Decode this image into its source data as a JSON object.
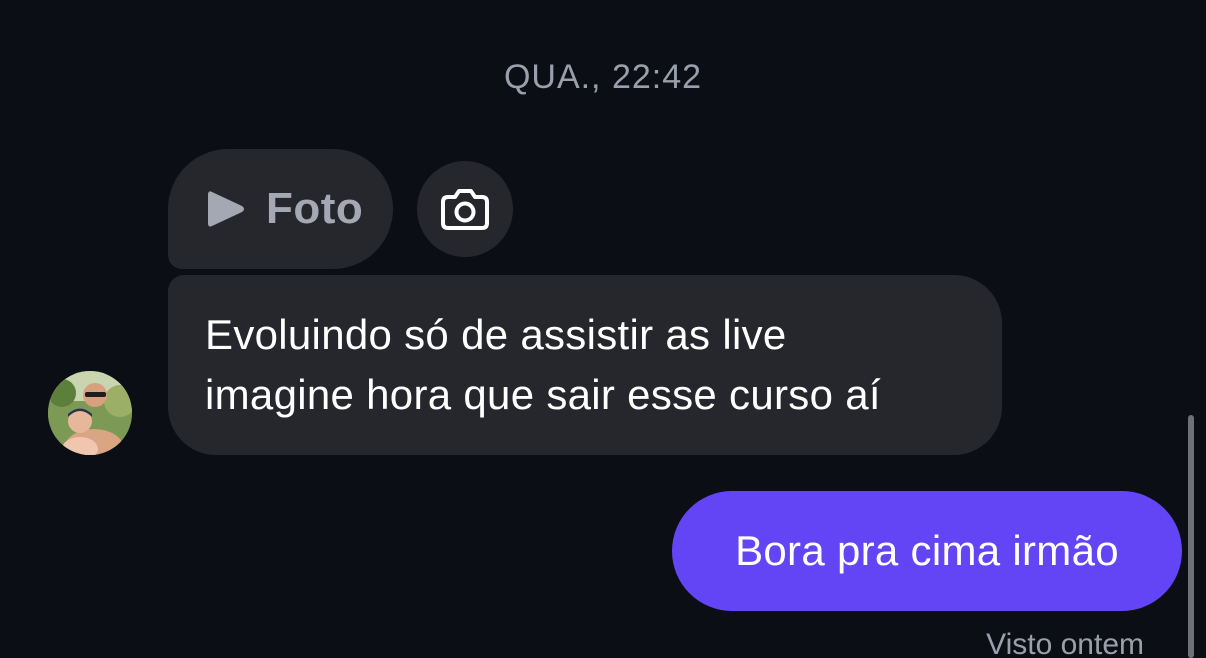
{
  "conversation": {
    "timestamp": "QUA., 22:42",
    "reply_preview": {
      "icon": "play-icon",
      "label": "Foto"
    },
    "camera_button": {
      "icon": "camera-icon"
    },
    "incoming_message": {
      "lines": [
        "Evoluindo só de assistir as live",
        "imagine hora que sair esse curso aí"
      ]
    },
    "outgoing_message": {
      "text": "Bora pra cima irmão"
    },
    "seen_status": "Visto ontem"
  },
  "colors": {
    "background": "#0b0e15",
    "incoming_bubble": "#25272d",
    "outgoing_bubble": "#6445f6",
    "muted_text": "#9aa0ab"
  }
}
